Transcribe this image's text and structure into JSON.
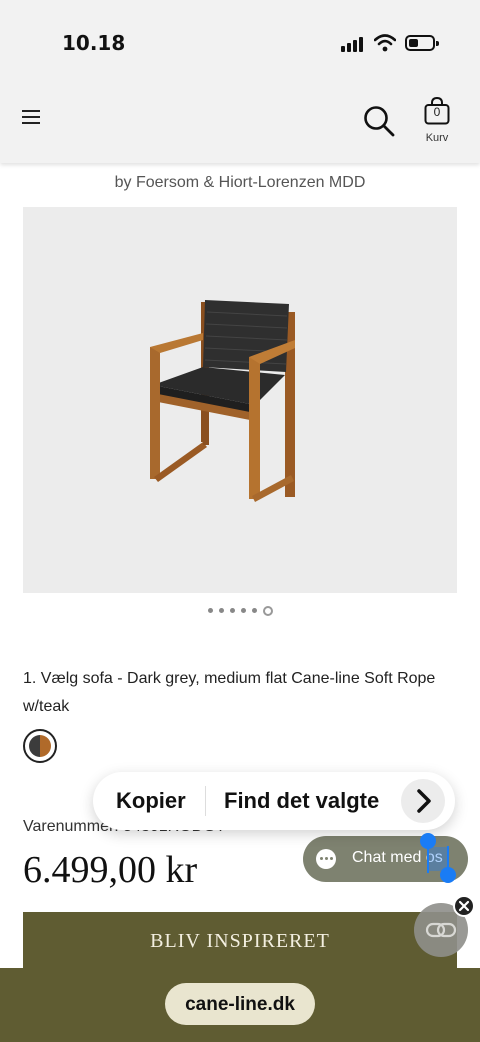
{
  "status_bar": {
    "time": "10.18"
  },
  "header": {
    "cart": {
      "count": "0",
      "label": "Kurv"
    }
  },
  "product": {
    "designer": "by Foersom & Hiort-Lorenzen MDD",
    "gallery": {
      "image_count": 6,
      "active_index": 5
    },
    "variant_text": "1. Vælg sofa - Dark grey, medium flat Cane-line Soft Rope w/teak",
    "swatch": {
      "name": "dark-grey-teak-swatch",
      "colors": [
        "#3c3c3c",
        "#b06a2a"
      ]
    },
    "sku_label": "Varenummer: 54301RODGT",
    "price": "6.499,00 kr"
  },
  "banner": {
    "label": "BLIV INSPIRERET"
  },
  "context_menu": {
    "copy_label": "Kopier",
    "lookup_label": "Find det valgte"
  },
  "chat": {
    "label": "Chat med os"
  },
  "browser": {
    "url": "cane-line.dk"
  },
  "colors": {
    "brand": "#5f5c32",
    "chat": "#7e8270",
    "selection": "#1a7cf5"
  }
}
